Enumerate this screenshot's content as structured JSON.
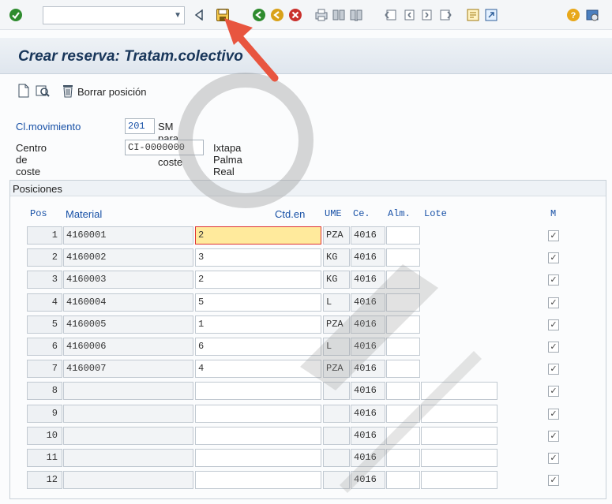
{
  "toolbar": {
    "icons": [
      "enter-check-icon",
      "back-triangle-icon",
      "save-icon",
      "back-icon",
      "exit-icon",
      "cancel-icon",
      "print-icon",
      "find-icon",
      "find-next-icon",
      "first-page-icon",
      "previous-page-icon",
      "next-page-icon",
      "last-page-icon",
      "new-session-icon",
      "shortcut-icon",
      "help-icon",
      "customize-layout-icon"
    ],
    "command_value": "",
    "accent": "#2e8b2e"
  },
  "title": {
    "text": "Crear reserva: Tratam.colectivo"
  },
  "app_toolbar": {
    "delete_label": "Borrar posición"
  },
  "form": {
    "movement_label": "Cl.movimiento",
    "movement_value": "201",
    "movement_desc": "SM para centro coste",
    "cost_center_label": "Centro de coste",
    "cost_center_value": "CI-0000000",
    "cost_center_desc": "Ixtapa Palma Real FO"
  },
  "positions": {
    "title": "Posiciones",
    "headers": {
      "pos": "Pos",
      "material": "Material",
      "qty": "Ctd.en",
      "ume": "UME",
      "plant": "Ce.",
      "storage": "Alm.",
      "batch": "Lote",
      "m": "M"
    },
    "rows": [
      {
        "pos": "1",
        "material": "4160001",
        "qty": "2",
        "ume": "PZA",
        "plant": "4016",
        "storage": "",
        "batch": "",
        "checked": true
      },
      {
        "pos": "2",
        "material": "4160002",
        "qty": "3",
        "ume": "KG",
        "plant": "4016",
        "storage": "",
        "batch": "",
        "checked": true
      },
      {
        "pos": "3",
        "material": "4160003",
        "qty": "2",
        "ume": "KG",
        "plant": "4016",
        "storage": "",
        "batch": "",
        "checked": true
      },
      {
        "pos": "4",
        "material": "4160004",
        "qty": "5",
        "ume": "L",
        "plant": "4016",
        "storage": "",
        "batch": "",
        "checked": true
      },
      {
        "pos": "5",
        "material": "4160005",
        "qty": "1",
        "ume": "PZA",
        "plant": "4016",
        "storage": "",
        "batch": "",
        "checked": true
      },
      {
        "pos": "6",
        "material": "4160006",
        "qty": "6",
        "ume": "L",
        "plant": "4016",
        "storage": "",
        "batch": "",
        "checked": true
      },
      {
        "pos": "7",
        "material": "4160007",
        "qty": "4",
        "ume": "PZA",
        "plant": "4016",
        "storage": "",
        "batch": "",
        "checked": true
      },
      {
        "pos": "8",
        "material": "",
        "qty": "",
        "ume": "",
        "plant": "4016",
        "storage": "",
        "batch": "",
        "checked": true
      },
      {
        "pos": "9",
        "material": "",
        "qty": "",
        "ume": "",
        "plant": "4016",
        "storage": "",
        "batch": "",
        "checked": true
      },
      {
        "pos": "10",
        "material": "",
        "qty": "",
        "ume": "",
        "plant": "4016",
        "storage": "",
        "batch": "",
        "checked": true
      },
      {
        "pos": "11",
        "material": "",
        "qty": "",
        "ume": "",
        "plant": "4016",
        "storage": "",
        "batch": "",
        "checked": true
      },
      {
        "pos": "12",
        "material": "",
        "qty": "",
        "ume": "",
        "plant": "4016",
        "storage": "",
        "batch": "",
        "checked": true
      }
    ]
  },
  "checkmark_glyph": "✓",
  "highlight_color": "#e8553f"
}
